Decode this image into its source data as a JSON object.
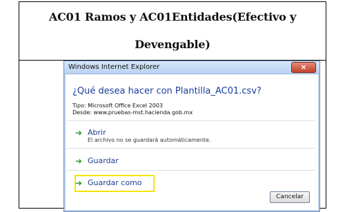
{
  "document": {
    "title_line_1": "AC01 Ramos y AC01Entidades(Efectivo y",
    "title_line_2": "Devengable)"
  },
  "dialog": {
    "title": "Windows Internet Explorer",
    "close_label": "×",
    "question": "¿Qué desea hacer con Plantilla_AC01.csv?",
    "type_label": "Tipo: Microsoft Office Excel 2003",
    "from_label": "Desde: www.pruebas-mst.hacienda.gob.mx",
    "actions": [
      {
        "label": "Abrir",
        "subtext": "El archivo no se guardará automáticamente."
      },
      {
        "label": "Guardar"
      },
      {
        "label": "Guardar como"
      }
    ],
    "cancel_label": "Cancelar"
  },
  "icons": {
    "arrow": "right-arrow-icon"
  },
  "colors": {
    "link_blue": "#1f3f8f",
    "arrow_green": "#2f9a2f",
    "highlight_yellow": "#f6e300",
    "close_red": "#c3412b"
  }
}
